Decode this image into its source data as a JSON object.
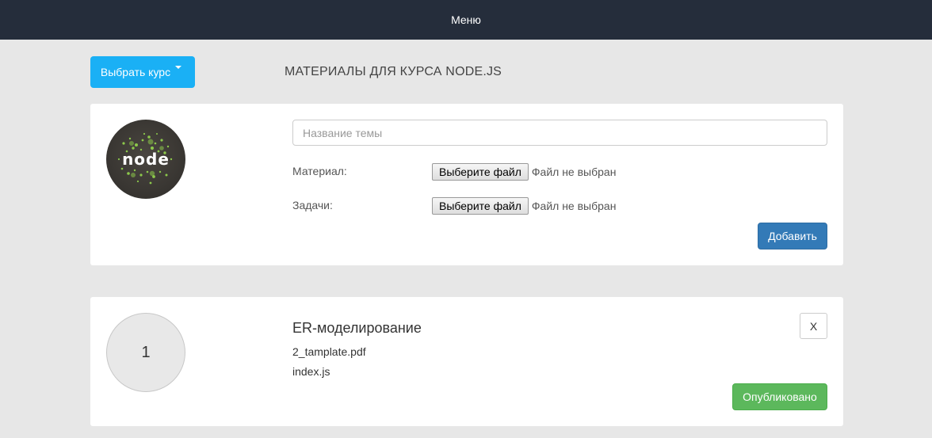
{
  "navbar": {
    "menu_label": "Меню"
  },
  "course_selector": {
    "label": "Выбрать курс"
  },
  "page": {
    "heading": "МАТЕРИАЛЫ ДЛЯ КУРСА NODE.JS"
  },
  "add_form": {
    "logo_text": "node",
    "topic_placeholder": "Название темы",
    "topic_value": "",
    "material_label": "Материал:",
    "tasks_label": "Задачи:",
    "choose_file_label": "Выберите файл",
    "no_file_label": "Файл не выбран",
    "add_button": "Добавить"
  },
  "topics": [
    {
      "number": "1",
      "title": "ER-моделирование",
      "files": [
        "2_tamplate.pdf",
        "index.js"
      ],
      "delete_label": "X",
      "status_label": "Опубликовано"
    }
  ],
  "colors": {
    "navbar_bg": "#252d3b",
    "page_bg": "#e7e7e7",
    "course_button": "#1ab0f5",
    "add_button": "#337ab7",
    "published_button": "#5cb85c",
    "nodejs_green": "#8cc84b"
  }
}
